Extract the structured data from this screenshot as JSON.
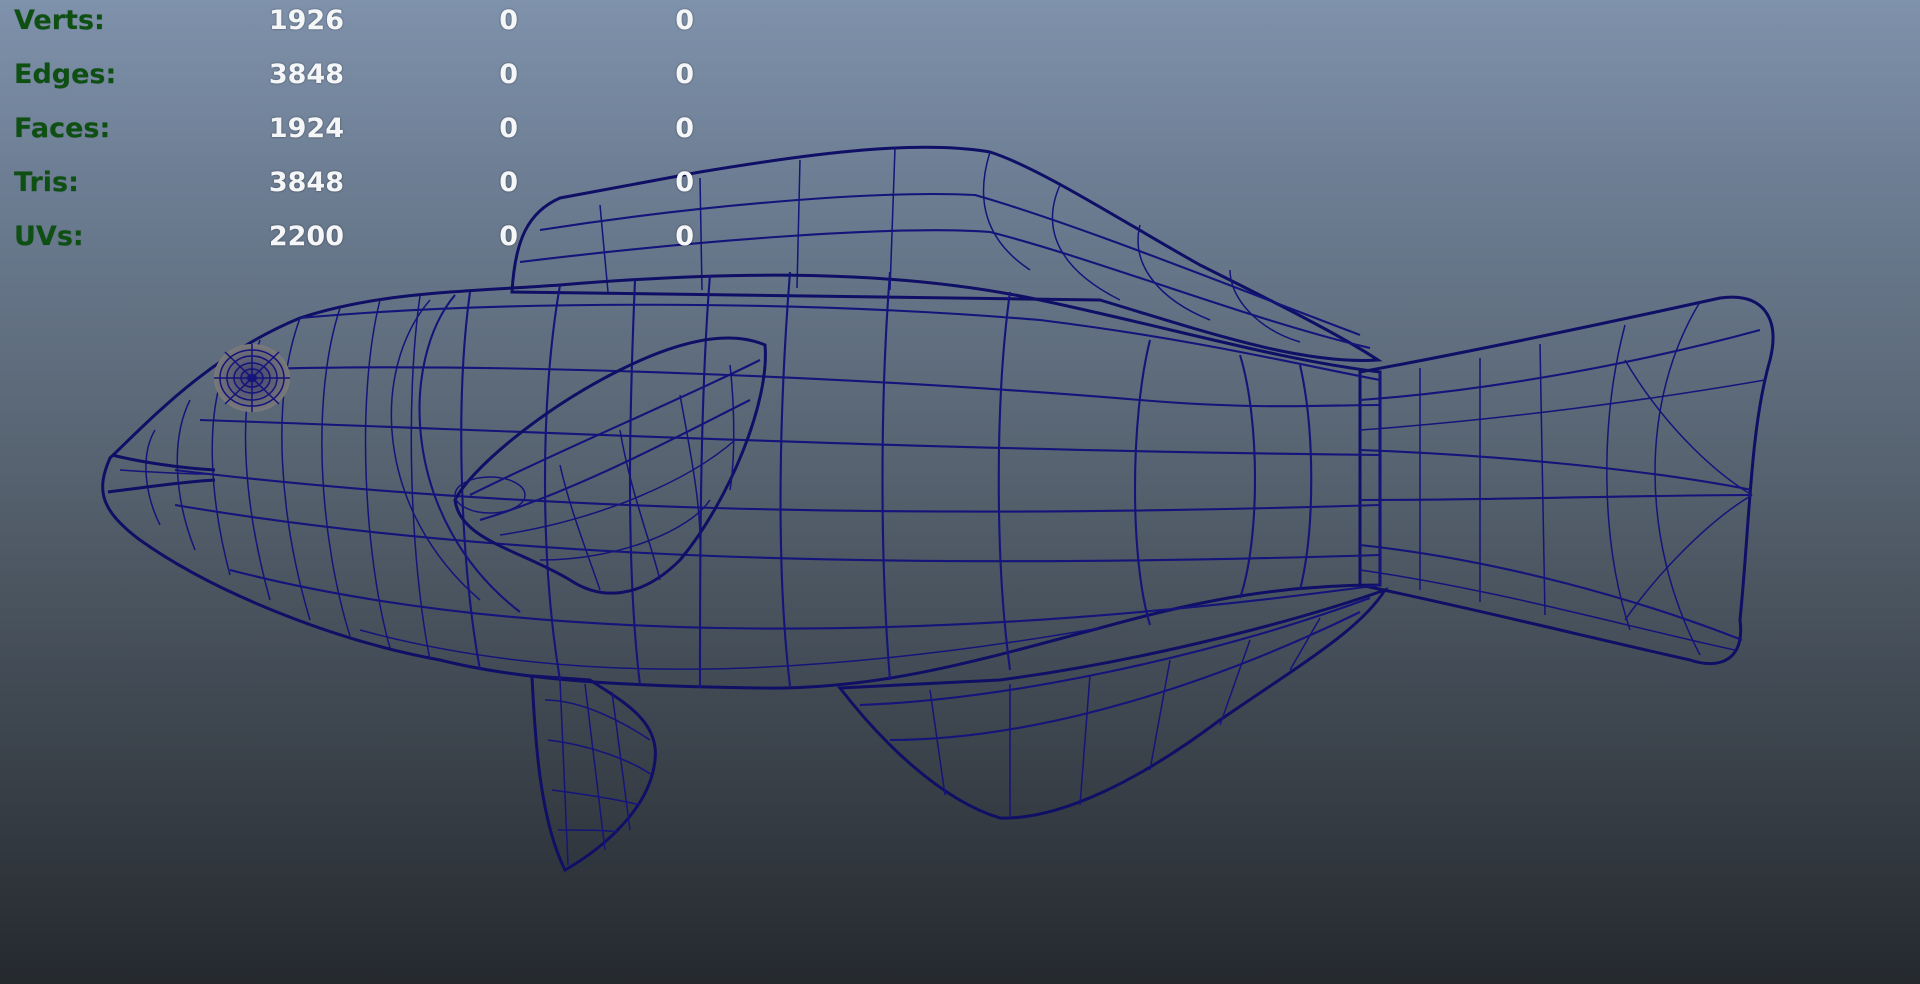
{
  "viewport": {
    "background_top": "#7f92ab",
    "background_bottom": "#25292e",
    "wire_color": "#14147a",
    "surface_color": "#808080"
  },
  "hud": {
    "label_color": "#0e4f12",
    "value_color": "#f4f6f8",
    "rows": [
      {
        "label": "Verts:",
        "values": [
          "1926",
          "0",
          "0"
        ]
      },
      {
        "label": "Edges:",
        "values": [
          "3848",
          "0",
          "0"
        ]
      },
      {
        "label": "Faces:",
        "values": [
          "1924",
          "0",
          "0"
        ]
      },
      {
        "label": "Tris:",
        "values": [
          "3848",
          "0",
          "0"
        ]
      },
      {
        "label": "UVs:",
        "values": [
          "2200",
          "0",
          "0"
        ]
      }
    ]
  }
}
